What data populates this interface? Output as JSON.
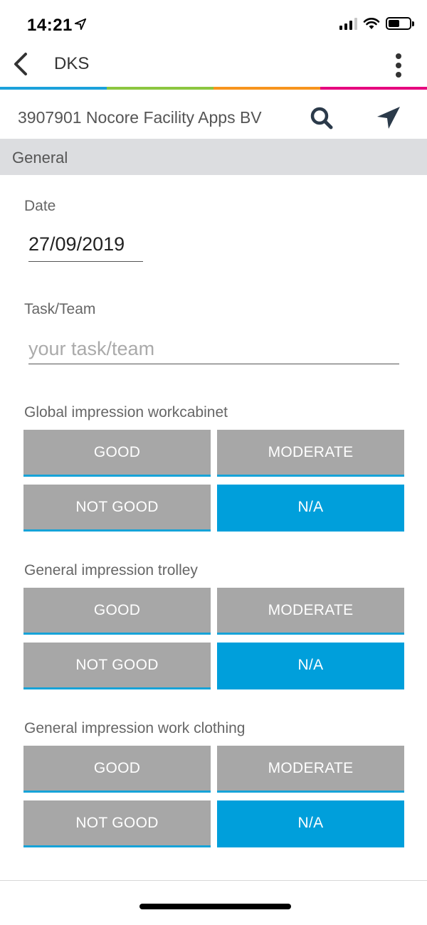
{
  "status": {
    "time": "14:21"
  },
  "app_bar": {
    "title": "DKS"
  },
  "client": {
    "name": "3907901 Nocore Facility Apps BV"
  },
  "section": {
    "title": "General"
  },
  "date_field": {
    "label": "Date",
    "value": "27/09/2019"
  },
  "task_field": {
    "label": "Task/Team",
    "placeholder": "your task/team",
    "value": ""
  },
  "questions": [
    {
      "label": "Global impression workcabinet",
      "options": [
        "GOOD",
        "MODERATE",
        "NOT GOOD",
        "N/A"
      ],
      "selected": "N/A"
    },
    {
      "label": "General impression trolley",
      "options": [
        "GOOD",
        "MODERATE",
        "NOT GOOD",
        "N/A"
      ],
      "selected": "N/A"
    },
    {
      "label": "General impression work clothing",
      "options": [
        "GOOD",
        "MODERATE",
        "NOT GOOD",
        "N/A"
      ],
      "selected": "N/A"
    }
  ],
  "colors": {
    "accent": "#009fdb",
    "button_gray": "#a7a7a7",
    "section_bg": "#dcdde0",
    "rainbow": [
      "#1ba1db",
      "#8cc63f",
      "#f7941d",
      "#e6007e"
    ]
  },
  "icons": [
    "back-arrow-icon",
    "more-vertical-icon",
    "search-icon",
    "navigation-arrow-icon",
    "location-arrow-icon",
    "signal-icon",
    "wifi-icon",
    "battery-icon"
  ]
}
